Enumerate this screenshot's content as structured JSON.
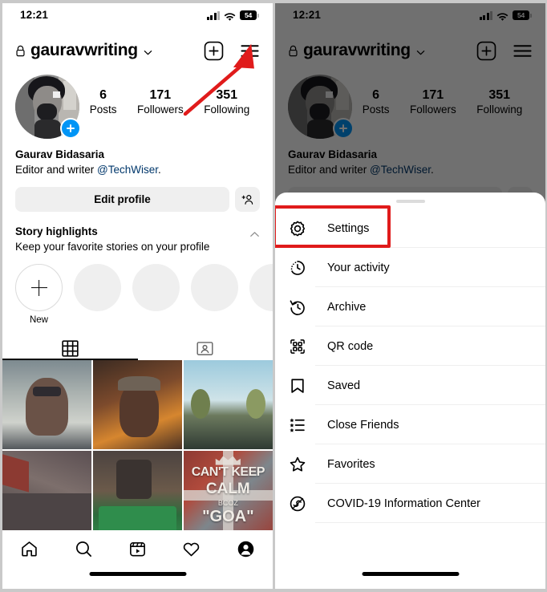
{
  "status_bar": {
    "time": "12:21",
    "battery_level": "54",
    "wifi_icon": "wifi-icon",
    "signal_icon": "cellular-signal-icon"
  },
  "profile": {
    "username": "gauravwriting",
    "lock_icon": "lock-icon",
    "chevron_icon": "chevron-down-icon",
    "add_post_icon": "plus-square-icon",
    "menu_icon": "hamburger-menu-icon",
    "avatar_icon": "profile-avatar",
    "add_story_icon": "plus-circle-badge",
    "stats": [
      {
        "value": "6",
        "label": "Posts"
      },
      {
        "value": "171",
        "label": "Followers"
      },
      {
        "value": "351",
        "label": "Following"
      }
    ],
    "full_name": "Gaurav Bidasaria",
    "bio_prefix": "Editor and writer ",
    "bio_mention": "@TechWiser",
    "bio_suffix": ".",
    "edit_profile_label": "Edit profile",
    "add_person_icon": "add-person-icon"
  },
  "story_highlights": {
    "title": "Story highlights",
    "subtitle": "Keep your favorite stories on your profile",
    "collapse_icon": "chevron-up-icon",
    "new_label": "New",
    "items": [
      "New",
      "",
      "",
      "",
      ""
    ]
  },
  "tabs": [
    {
      "name": "grid-tab",
      "icon": "grid-icon",
      "active": true
    },
    {
      "name": "tagged-tab",
      "icon": "tagged-person-icon",
      "active": false
    }
  ],
  "photo_grid": [
    {
      "alt": "man-in-car-selfie"
    },
    {
      "alt": "man-with-hat-mall-christmas-tree"
    },
    {
      "alt": "beach-coconuts"
    },
    {
      "alt": "road-gravel-perspective"
    },
    {
      "alt": "pool-table-snooker"
    },
    {
      "alt": "cant-keep-calm-goa-poster",
      "text_lines": [
        "CAN'T KEEP",
        "CALM",
        "BCOZ",
        "\"GOA\""
      ]
    }
  ],
  "bottom_nav": [
    {
      "name": "home-tab",
      "icon": "home-icon"
    },
    {
      "name": "search-tab",
      "icon": "search-icon"
    },
    {
      "name": "reels-tab",
      "icon": "reels-icon"
    },
    {
      "name": "activity-tab",
      "icon": "heart-icon"
    },
    {
      "name": "profile-tab",
      "icon": "profile-icon"
    }
  ],
  "menu_sheet": {
    "drag_handle": "drag-handle",
    "items": [
      {
        "label": "Settings",
        "icon": "settings-gear-icon",
        "highlighted": true
      },
      {
        "label": "Your activity",
        "icon": "clock-activity-icon",
        "highlighted": false
      },
      {
        "label": "Archive",
        "icon": "archive-clock-back-icon",
        "highlighted": false
      },
      {
        "label": "QR code",
        "icon": "qr-code-icon",
        "highlighted": false
      },
      {
        "label": "Saved",
        "icon": "bookmark-icon",
        "highlighted": false
      },
      {
        "label": "Close Friends",
        "icon": "close-friends-list-icon",
        "highlighted": false
      },
      {
        "label": "Favorites",
        "icon": "star-icon",
        "highlighted": false
      },
      {
        "label": "COVID-19 Information Center",
        "icon": "covid-info-icon",
        "highlighted": false
      }
    ]
  },
  "annotations": {
    "arrow_color": "#e01b1b",
    "highlight_box_color": "#e01b1b",
    "arrow_target": "hamburger-menu-icon",
    "highlight_target": "Settings"
  },
  "colors": {
    "accent_blue": "#0095f6",
    "link_blue": "#00376b",
    "chip_gray": "#efefef",
    "annotation_red": "#e01b1b"
  }
}
